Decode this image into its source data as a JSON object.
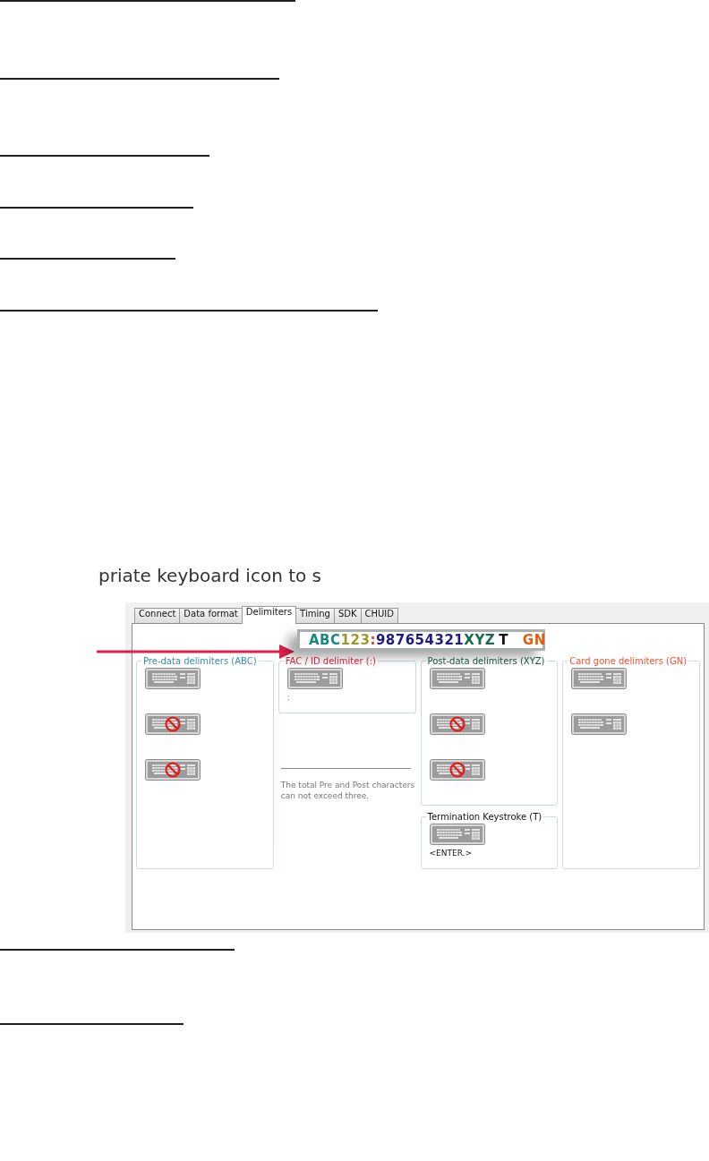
{
  "caption": "priate keyboard icon to s",
  "tabs": [
    {
      "label": "Connect",
      "selected": false
    },
    {
      "label": "Data format",
      "selected": false
    },
    {
      "label": "Delimiters",
      "selected": true
    },
    {
      "label": "Timing",
      "selected": false
    },
    {
      "label": "SDK",
      "selected": false
    },
    {
      "label": "CHUID",
      "selected": false
    }
  ],
  "preview": [
    {
      "text": "ABC",
      "color": "#1a8a80"
    },
    {
      "text": "123",
      "color": "#9a9a2a"
    },
    {
      "text": ":",
      "color": "#e8402a"
    },
    {
      "text": "987654321",
      "color": "#1c1c80"
    },
    {
      "text": "XYZ",
      "color": "#1a6a50"
    },
    {
      "text": "T",
      "color": "#111111"
    },
    {
      "text": "GN",
      "color": "#e06010"
    }
  ],
  "groups": [
    {
      "title": "Pre-data delimiters (ABC)",
      "color": "#3a8ab0",
      "keys": [
        {
          "blocked": false
        },
        {
          "blocked": true
        },
        {
          "blocked": true
        }
      ]
    },
    {
      "title": "FAC / ID delimiter (:)",
      "color": "#e8203a",
      "keys": [
        {
          "blocked": false
        }
      ],
      "value": ":"
    },
    {
      "title": "Post-data delimiters (XYZ)",
      "color": "#1a5a40",
      "keys": [
        {
          "blocked": false
        },
        {
          "blocked": true
        },
        {
          "blocked": true
        }
      ]
    },
    {
      "title": "Termination Keystroke (T)",
      "color": "#111111",
      "keys": [
        {
          "blocked": false
        }
      ],
      "value": "<ENTER.>"
    },
    {
      "title": "Card gone delimiters (GN)",
      "color": "#f05030",
      "keys": [
        {
          "blocked": false
        },
        {
          "blocked": false
        }
      ]
    }
  ],
  "note": "The total Pre and Post characters can not exceed three."
}
